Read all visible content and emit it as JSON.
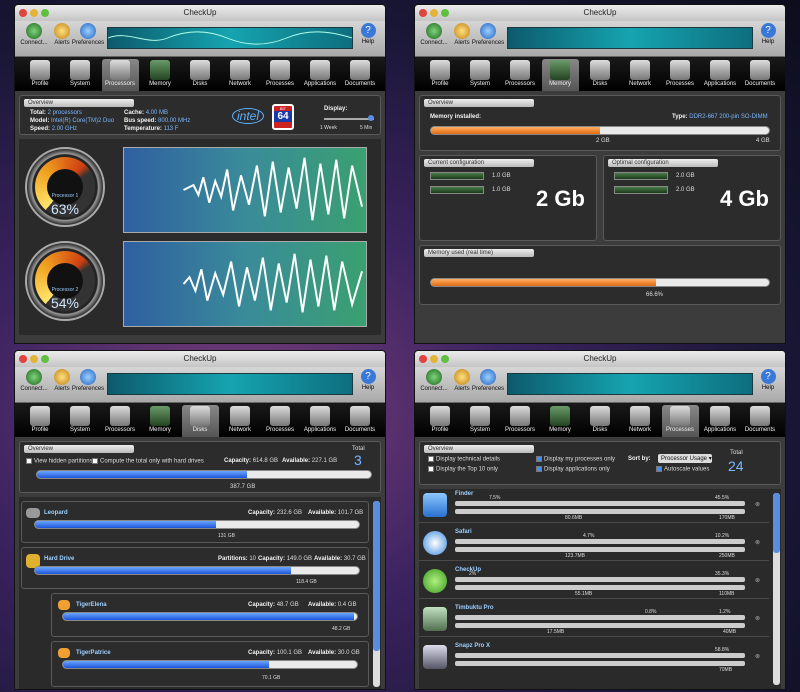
{
  "app": {
    "title": "CheckUp",
    "connect": "Connect...",
    "alerts": "Alerts",
    "preferences": "Preferences",
    "help": "Help"
  },
  "tabs": [
    "Profile",
    "System",
    "Processors",
    "Memory",
    "Disks",
    "Network",
    "Processes",
    "Applications",
    "Documents"
  ],
  "cpu": {
    "overview": "Overview",
    "total_l": "Total:",
    "total": "2 processors",
    "model_l": "Model:",
    "model": "Intel(R) Core(TM)2 Duo",
    "speed_l": "Speed:",
    "speed": "2.00 GHz",
    "cache_l": "Cache:",
    "cache": "4.00 MB",
    "bus_l": "Bus speed:",
    "bus": "800.00 MHz",
    "temp_l": "Temperature:",
    "temp": "113 F",
    "intel": "intel",
    "sixtyfour": "64",
    "bits": "BIT",
    "display": "Display:",
    "week": "1 Week",
    "min": "5 Min",
    "p1": "Processor 1",
    "p1pct": "63%",
    "p2": "Processor 2",
    "p2pct": "54%"
  },
  "memory": {
    "overview": "Overview",
    "installed": "Memory installed:",
    "type_l": "Type:",
    "type": "DDR2-667 200-pin SO-DIMM",
    "marker": "2 GB",
    "max": "4 GB",
    "fill": 0.5,
    "current": "Current configuration",
    "c1": "1.0 GB",
    "c2": "1.0 GB",
    "big1": "2 Gb",
    "optimal": "Optimal configuration",
    "o1": "2.0 GB",
    "o2": "2.0 GB",
    "big2": "4 Gb",
    "used": "Memory used (real time)",
    "usedpct": "66.6%",
    "usedfill": 0.666
  },
  "disks": {
    "overview": "Overview",
    "total_l": "Total",
    "total": "3",
    "hidden": "View hidden partitions",
    "compute": "Compute the total only with hard drives",
    "cap_l": "Capacity:",
    "cap": "614.8 GB",
    "avail_l": "Available:",
    "avail": "227.1 GB",
    "used": "387.7 GB",
    "usedfill": 0.63,
    "items": [
      {
        "name": "Leopard",
        "partitions": "",
        "cap": "232.6 GB",
        "avail": "101.7 GB",
        "used": "131 GB",
        "fill": 0.56
      },
      {
        "name": "Hard Drive",
        "partitions": "10",
        "cap": "149.0 GB",
        "avail": "30.7 GB",
        "used": "118.4 GB",
        "fill": 0.79
      },
      {
        "name": "TigerElena",
        "partitions": "",
        "cap": "48.7 GB",
        "avail": "0.4 GB",
        "used": "48.2 GB",
        "fill": 0.99
      },
      {
        "name": "TigerPatrice",
        "partitions": "",
        "cap": "100.1 GB",
        "avail": "30.0 GB",
        "used": "70.1 GB",
        "fill": 0.7
      }
    ],
    "part_l": "Partitions:"
  },
  "processes": {
    "overview": "Overview",
    "tech": "Display technical details",
    "top10": "Display the Top 10 only",
    "mine": "Display my processes only",
    "apps": "Display applications only",
    "sort_l": "Sort by:",
    "sort": "Processor Usage",
    "autoscale": "Autoscale values",
    "total_l": "Total",
    "total": "24",
    "items": [
      {
        "name": "Finder",
        "cpu": "7.5%",
        "cpumax": "45.5%",
        "mem": "80.6MB",
        "memmax": "170MB",
        "cpuf": 0.16,
        "memf": 0.47
      },
      {
        "name": "Safari",
        "cpu": "4.7%",
        "cpumax": "10.2%",
        "mem": "123.7MB",
        "memmax": "250MB",
        "cpuf": 0.46,
        "memf": 0.49
      },
      {
        "name": "CheckUp",
        "cpu": "2%",
        "cpumax": "35.3%",
        "mem": "55.1MB",
        "memmax": "110MB",
        "cpuf": 0.06,
        "memf": 0.5
      },
      {
        "name": "Timbuktu Pro",
        "cpu": "0.8%",
        "cpumax": "1.2%",
        "mem": "17.5MB",
        "memmax": "40MB",
        "cpuf": 0.66,
        "memf": 0.44
      },
      {
        "name": "Snapz Pro X",
        "cpu": "",
        "cpumax": "58.8%",
        "mem": "",
        "memmax": "70MB",
        "cpuf": 0.35,
        "memf": 0.4
      }
    ]
  }
}
